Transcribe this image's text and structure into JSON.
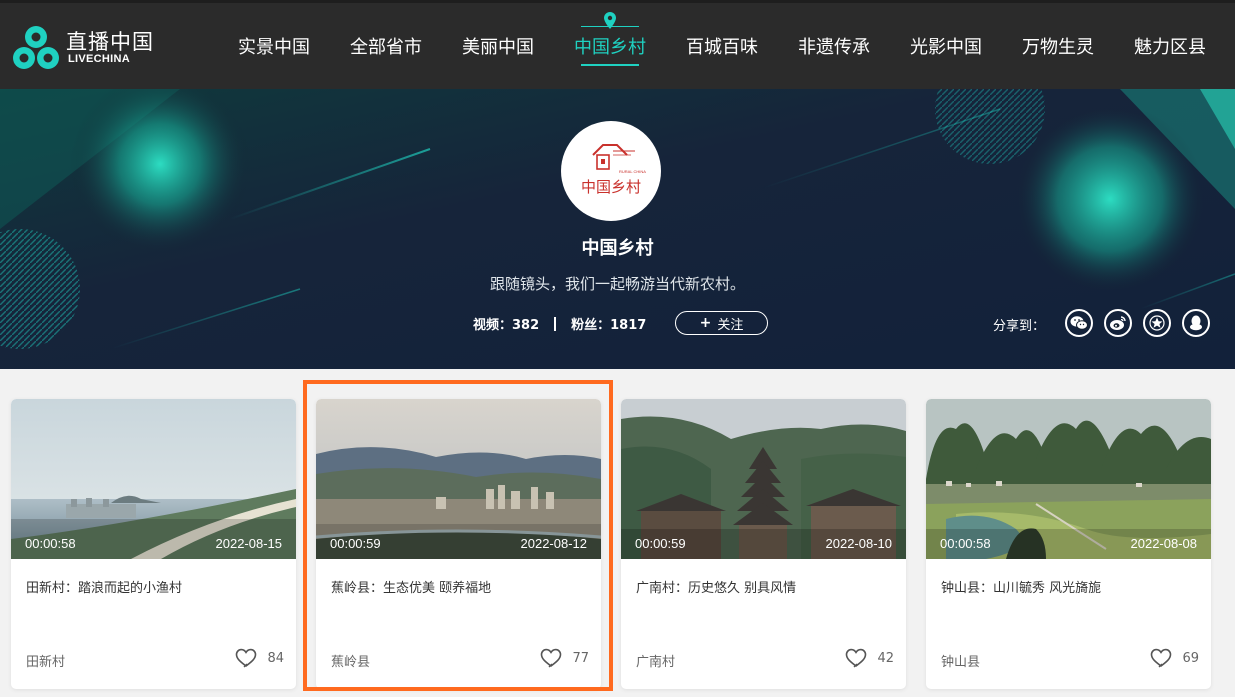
{
  "header": {
    "logo_cn": "直播中国",
    "logo_en": "LIVECHINA",
    "nav": [
      {
        "label": "实景中国",
        "active": false
      },
      {
        "label": "全部省市",
        "active": false
      },
      {
        "label": "美丽中国",
        "active": false
      },
      {
        "label": "中国乡村",
        "active": true
      },
      {
        "label": "百城百味",
        "active": false
      },
      {
        "label": "非遗传承",
        "active": false
      },
      {
        "label": "光影中国",
        "active": false
      },
      {
        "label": "万物生灵",
        "active": false
      },
      {
        "label": "魅力区县",
        "active": false
      }
    ]
  },
  "channel": {
    "avatar_text": "中国乡村",
    "avatar_sub": "RURAL CHINA",
    "title": "中国乡村",
    "description": "跟随镜头，我们一起畅游当代新农村。",
    "videos_label": "视频：382",
    "fans_label": "粉丝：1817",
    "follow_label": "关注",
    "share_label": "分享到："
  },
  "share_icons": [
    "wechat-icon",
    "weibo-icon",
    "qzone-icon",
    "qq-icon"
  ],
  "colors": {
    "accent": "#1fd1c1",
    "header_bg": "#2b2b2b",
    "banner_bg": "#14202e",
    "highlight": "#ff6a1f"
  },
  "cards": [
    {
      "duration": "00:00:58",
      "date": "2022-08-15",
      "title": "田新村：踏浪而起的小渔村",
      "tag": "田新村",
      "likes": "84",
      "scene": "sea"
    },
    {
      "duration": "00:00:59",
      "date": "2022-08-12",
      "title": "蕉岭县：生态优美 颐养福地",
      "tag": "蕉岭县",
      "likes": "77",
      "scene": "town"
    },
    {
      "duration": "00:00:59",
      "date": "2022-08-10",
      "title": "广南村：历史悠久 别具风情",
      "tag": "广南村",
      "likes": "42",
      "scene": "tower"
    },
    {
      "duration": "00:00:58",
      "date": "2022-08-08",
      "title": "钟山县：山川毓秀 风光旖旎",
      "tag": "钟山县",
      "likes": "69",
      "scene": "karst"
    }
  ]
}
